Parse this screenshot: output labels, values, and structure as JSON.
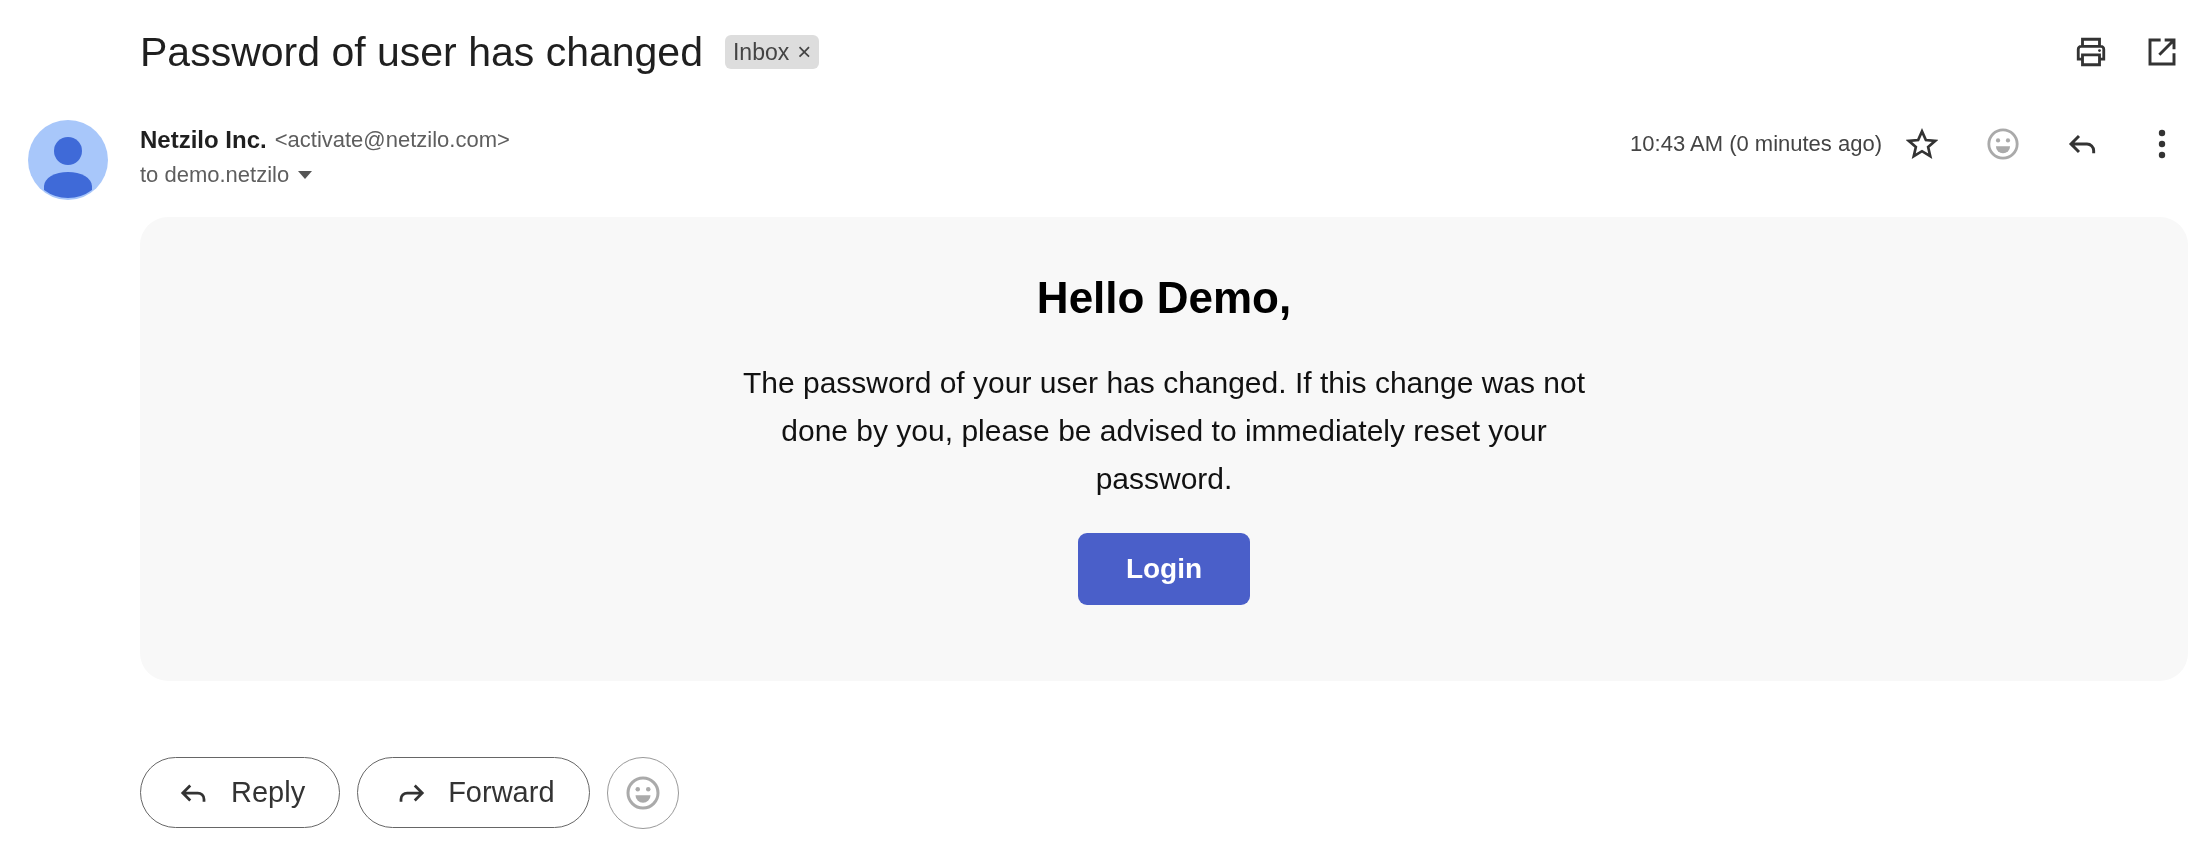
{
  "subject": "Password of user has changed",
  "label": {
    "text": "Inbox",
    "remove": "×"
  },
  "sender": {
    "name": "Netzilo Inc.",
    "email": "<activate@netzilo.com>",
    "recipient": "to demo.netzilo"
  },
  "time": "10:43 AM (0 minutes ago)",
  "message": {
    "heading": "Hello Demo,",
    "body": "The password of your user has changed. If this change was not done by you, please be advised to immediately reset your password.",
    "button": "Login"
  },
  "actions": [
    {
      "kind": "reply",
      "label": "Reply"
    },
    {
      "kind": "forward",
      "label": "Forward"
    },
    {
      "kind": "emoji"
    }
  ]
}
